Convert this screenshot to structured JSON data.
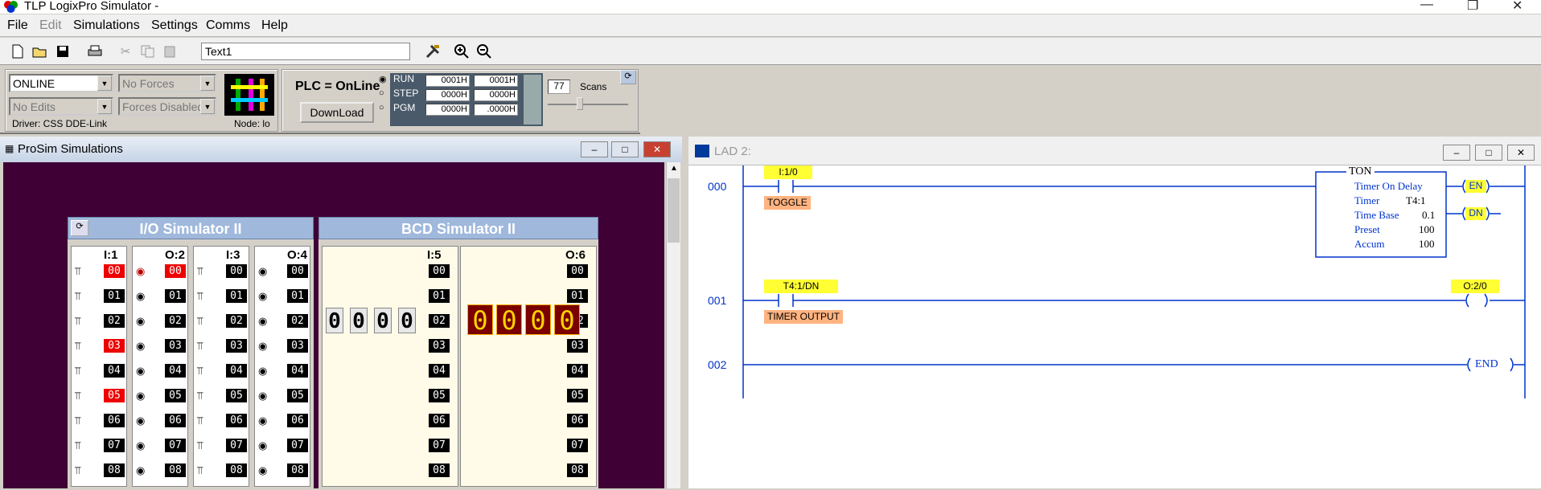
{
  "window": {
    "title": "TLP LogixPro Simulator  -"
  },
  "menu": [
    "File",
    "Edit",
    "Simulations",
    "Settings",
    "Comms",
    "Help"
  ],
  "toolbar": {
    "text_value": "Text1",
    "icons": [
      "new-icon",
      "open-icon",
      "save-icon",
      "print-icon",
      "cut-icon",
      "copy-icon",
      "paste-icon",
      "tools-icon",
      "zoom-in-icon",
      "zoom-out-icon"
    ]
  },
  "control": {
    "mode": "ONLINE",
    "forces": "No Forces",
    "edits": "No Edits",
    "forces_enabled": "Forces Disabled",
    "driver": "Driver: CSS DDE-Link",
    "node": "Node: lo",
    "plc_status": "PLC = OnLine",
    "download": "DownLoad",
    "run": "RUN",
    "step": "STEP",
    "pgm": "PGM",
    "reg": [
      "0001H",
      "0001H",
      "0000H",
      "0000H",
      "0000H",
      ".0000H"
    ],
    "scans_value": "77",
    "scans_label": "Scans"
  },
  "prosim": {
    "title": "ProSim Simulations",
    "io_title": "I/O Simulator II",
    "bcd_title": "BCD Simulator II",
    "modules": [
      "I:1",
      "O:2",
      "I:3",
      "O:4",
      "I:5",
      "O:6"
    ],
    "addresses": [
      "00",
      "01",
      "02",
      "03",
      "04",
      "05",
      "06",
      "07",
      "08"
    ],
    "i1_on": [
      "00",
      "03",
      "05"
    ],
    "o2_on": [
      "00"
    ],
    "bcd_in": [
      "0",
      "0",
      "0",
      "0"
    ],
    "bcd_out": [
      "0",
      "0",
      "0",
      "0"
    ]
  },
  "lad": {
    "title": "LAD 2:",
    "rungs": [
      "000",
      "001",
      "002"
    ],
    "r0_tag": "I:1/0",
    "r0_desc": "TOGGLE",
    "ton": {
      "name": "TON",
      "desc": "Timer On Delay",
      "timer_label": "Timer",
      "timer": "T4:1",
      "tb_label": "Time Base",
      "tb": "0.1",
      "preset_label": "Preset",
      "preset": "100",
      "accum_label": "Accum",
      "accum": "100",
      "en": "EN",
      "dn": "DN"
    },
    "r1_tag": "T4:1/DN",
    "r1_desc": "TIMER OUTPUT",
    "r1_out": "O:2/0",
    "end": "END"
  },
  "colors": {
    "prosim_bg": "#3e0035",
    "tag": "#ffff33",
    "desc": "#ffb380",
    "wire": "#0033cc"
  }
}
